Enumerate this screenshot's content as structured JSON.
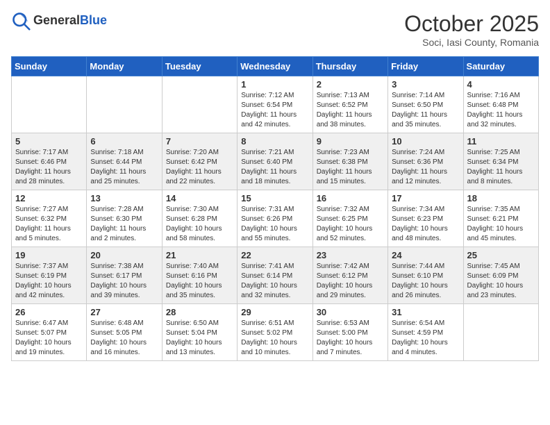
{
  "header": {
    "logo_general": "General",
    "logo_blue": "Blue",
    "month_title": "October 2025",
    "location": "Soci, Iasi County, Romania"
  },
  "days_of_week": [
    "Sunday",
    "Monday",
    "Tuesday",
    "Wednesday",
    "Thursday",
    "Friday",
    "Saturday"
  ],
  "weeks": [
    [
      {
        "day": "",
        "info": ""
      },
      {
        "day": "",
        "info": ""
      },
      {
        "day": "",
        "info": ""
      },
      {
        "day": "1",
        "info": "Sunrise: 7:12 AM\nSunset: 6:54 PM\nDaylight: 11 hours and 42 minutes."
      },
      {
        "day": "2",
        "info": "Sunrise: 7:13 AM\nSunset: 6:52 PM\nDaylight: 11 hours and 38 minutes."
      },
      {
        "day": "3",
        "info": "Sunrise: 7:14 AM\nSunset: 6:50 PM\nDaylight: 11 hours and 35 minutes."
      },
      {
        "day": "4",
        "info": "Sunrise: 7:16 AM\nSunset: 6:48 PM\nDaylight: 11 hours and 32 minutes."
      }
    ],
    [
      {
        "day": "5",
        "info": "Sunrise: 7:17 AM\nSunset: 6:46 PM\nDaylight: 11 hours and 28 minutes."
      },
      {
        "day": "6",
        "info": "Sunrise: 7:18 AM\nSunset: 6:44 PM\nDaylight: 11 hours and 25 minutes."
      },
      {
        "day": "7",
        "info": "Sunrise: 7:20 AM\nSunset: 6:42 PM\nDaylight: 11 hours and 22 minutes."
      },
      {
        "day": "8",
        "info": "Sunrise: 7:21 AM\nSunset: 6:40 PM\nDaylight: 11 hours and 18 minutes."
      },
      {
        "day": "9",
        "info": "Sunrise: 7:23 AM\nSunset: 6:38 PM\nDaylight: 11 hours and 15 minutes."
      },
      {
        "day": "10",
        "info": "Sunrise: 7:24 AM\nSunset: 6:36 PM\nDaylight: 11 hours and 12 minutes."
      },
      {
        "day": "11",
        "info": "Sunrise: 7:25 AM\nSunset: 6:34 PM\nDaylight: 11 hours and 8 minutes."
      }
    ],
    [
      {
        "day": "12",
        "info": "Sunrise: 7:27 AM\nSunset: 6:32 PM\nDaylight: 11 hours and 5 minutes."
      },
      {
        "day": "13",
        "info": "Sunrise: 7:28 AM\nSunset: 6:30 PM\nDaylight: 11 hours and 2 minutes."
      },
      {
        "day": "14",
        "info": "Sunrise: 7:30 AM\nSunset: 6:28 PM\nDaylight: 10 hours and 58 minutes."
      },
      {
        "day": "15",
        "info": "Sunrise: 7:31 AM\nSunset: 6:26 PM\nDaylight: 10 hours and 55 minutes."
      },
      {
        "day": "16",
        "info": "Sunrise: 7:32 AM\nSunset: 6:25 PM\nDaylight: 10 hours and 52 minutes."
      },
      {
        "day": "17",
        "info": "Sunrise: 7:34 AM\nSunset: 6:23 PM\nDaylight: 10 hours and 48 minutes."
      },
      {
        "day": "18",
        "info": "Sunrise: 7:35 AM\nSunset: 6:21 PM\nDaylight: 10 hours and 45 minutes."
      }
    ],
    [
      {
        "day": "19",
        "info": "Sunrise: 7:37 AM\nSunset: 6:19 PM\nDaylight: 10 hours and 42 minutes."
      },
      {
        "day": "20",
        "info": "Sunrise: 7:38 AM\nSunset: 6:17 PM\nDaylight: 10 hours and 39 minutes."
      },
      {
        "day": "21",
        "info": "Sunrise: 7:40 AM\nSunset: 6:16 PM\nDaylight: 10 hours and 35 minutes."
      },
      {
        "day": "22",
        "info": "Sunrise: 7:41 AM\nSunset: 6:14 PM\nDaylight: 10 hours and 32 minutes."
      },
      {
        "day": "23",
        "info": "Sunrise: 7:42 AM\nSunset: 6:12 PM\nDaylight: 10 hours and 29 minutes."
      },
      {
        "day": "24",
        "info": "Sunrise: 7:44 AM\nSunset: 6:10 PM\nDaylight: 10 hours and 26 minutes."
      },
      {
        "day": "25",
        "info": "Sunrise: 7:45 AM\nSunset: 6:09 PM\nDaylight: 10 hours and 23 minutes."
      }
    ],
    [
      {
        "day": "26",
        "info": "Sunrise: 6:47 AM\nSunset: 5:07 PM\nDaylight: 10 hours and 19 minutes."
      },
      {
        "day": "27",
        "info": "Sunrise: 6:48 AM\nSunset: 5:05 PM\nDaylight: 10 hours and 16 minutes."
      },
      {
        "day": "28",
        "info": "Sunrise: 6:50 AM\nSunset: 5:04 PM\nDaylight: 10 hours and 13 minutes."
      },
      {
        "day": "29",
        "info": "Sunrise: 6:51 AM\nSunset: 5:02 PM\nDaylight: 10 hours and 10 minutes."
      },
      {
        "day": "30",
        "info": "Sunrise: 6:53 AM\nSunset: 5:00 PM\nDaylight: 10 hours and 7 minutes."
      },
      {
        "day": "31",
        "info": "Sunrise: 6:54 AM\nSunset: 4:59 PM\nDaylight: 10 hours and 4 minutes."
      },
      {
        "day": "",
        "info": ""
      }
    ]
  ]
}
